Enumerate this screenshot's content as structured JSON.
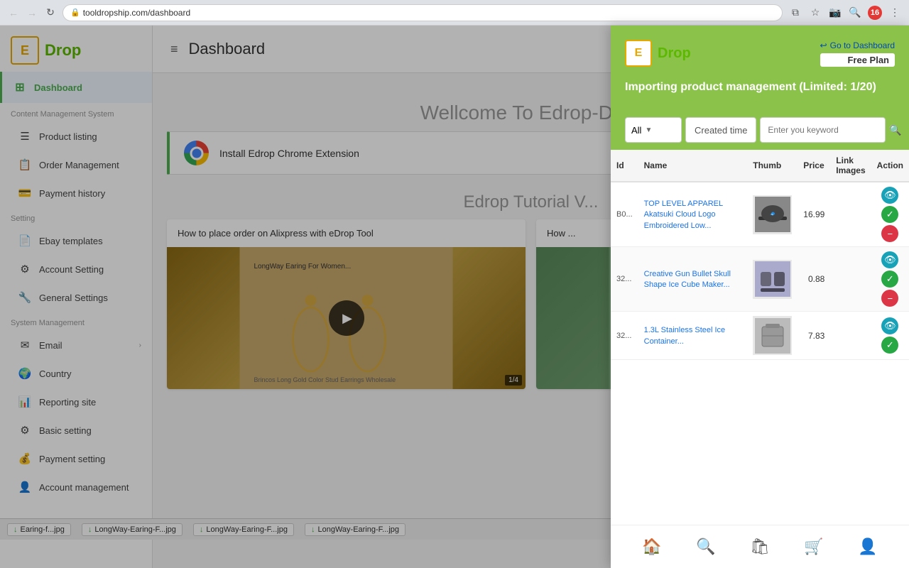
{
  "browser": {
    "url": "tooldropship.com/dashboard",
    "back_tooltip": "Back",
    "forward_tooltip": "Forward",
    "refresh_tooltip": "Refresh"
  },
  "sidebar": {
    "logo_letter": "E",
    "logo_name": "Drop",
    "nav_items": [
      {
        "id": "dashboard",
        "label": "Dashboard",
        "icon": "⊞",
        "active": true
      },
      {
        "id": "content-management",
        "label": "Content Management System",
        "icon": "",
        "section_label": true
      },
      {
        "id": "product-listing",
        "label": "Product listing",
        "icon": "☰"
      },
      {
        "id": "order-management",
        "label": "Order Management",
        "icon": "📋"
      },
      {
        "id": "payment-history",
        "label": "Payment history",
        "icon": "💳"
      },
      {
        "id": "setting",
        "label": "Setting",
        "icon": "",
        "section_label": true
      },
      {
        "id": "ebay-templates",
        "label": "Ebay templates",
        "icon": "📄"
      },
      {
        "id": "account-setting",
        "label": "Account Setting",
        "icon": "⚙"
      },
      {
        "id": "general-settings",
        "label": "General Settings",
        "icon": "🔧"
      },
      {
        "id": "system-management",
        "label": "System Management",
        "icon": "",
        "section_label": true
      },
      {
        "id": "email",
        "label": "Email",
        "icon": "✉",
        "has_chevron": true
      },
      {
        "id": "country",
        "label": "Country",
        "icon": "🌍"
      },
      {
        "id": "reporting-site",
        "label": "Reporting site",
        "icon": "📊"
      },
      {
        "id": "basic-setting",
        "label": "Basic setting",
        "icon": "⚙"
      },
      {
        "id": "payment-setting",
        "label": "Payment setting",
        "icon": "💰"
      },
      {
        "id": "account-management",
        "label": "Account management",
        "icon": "👤"
      }
    ]
  },
  "main": {
    "title": "Dashboard",
    "welcome_text": "Wellcome To Edrop-Drop",
    "chrome_banner_text": "Install Edrop Chrome Extension",
    "tutorial_title": "Edrop Tutorial V...",
    "video1_title": "How to place order on Alixpress with eDrop Tool",
    "video2_title": "How ...",
    "video1_overlay": "1/4",
    "video2_overlay": ""
  },
  "popup": {
    "logo_letter": "E",
    "logo_name": "Drop",
    "dashboard_link": "Go to Dashboard",
    "plan_label": "Free Plan",
    "title": "Importing product management (Limited: 1/20)",
    "filter_label": "All",
    "created_time_label": "Created time",
    "search_placeholder": "Enter you keyword",
    "table_headers": [
      "Id",
      "Name",
      "Thumb",
      "Price",
      "Link Images",
      "Action"
    ],
    "products": [
      {
        "id": "B0...",
        "name": "TOP LEVEL APPAREL Akatsuki Cloud Logo Embroidered Low...",
        "price": "16.99",
        "thumb_type": "hat"
      },
      {
        "id": "32...",
        "name": "Creative Gun Bullet Skull Shape Ice Cube Maker...",
        "price": "0.88",
        "thumb_type": "ice"
      },
      {
        "id": "32...",
        "name": "1.3L Stainless Steel Ice Container...",
        "price": "7.83",
        "thumb_type": "container"
      }
    ],
    "footer_icons": [
      "home",
      "search",
      "bag",
      "cart",
      "user"
    ]
  },
  "downloads": [
    "Earing-f...jpg",
    "LongWay-Earing-F...jpg",
    "LongWay-Earing-F...jpg",
    "LongWay-Earing-F...jpg"
  ]
}
